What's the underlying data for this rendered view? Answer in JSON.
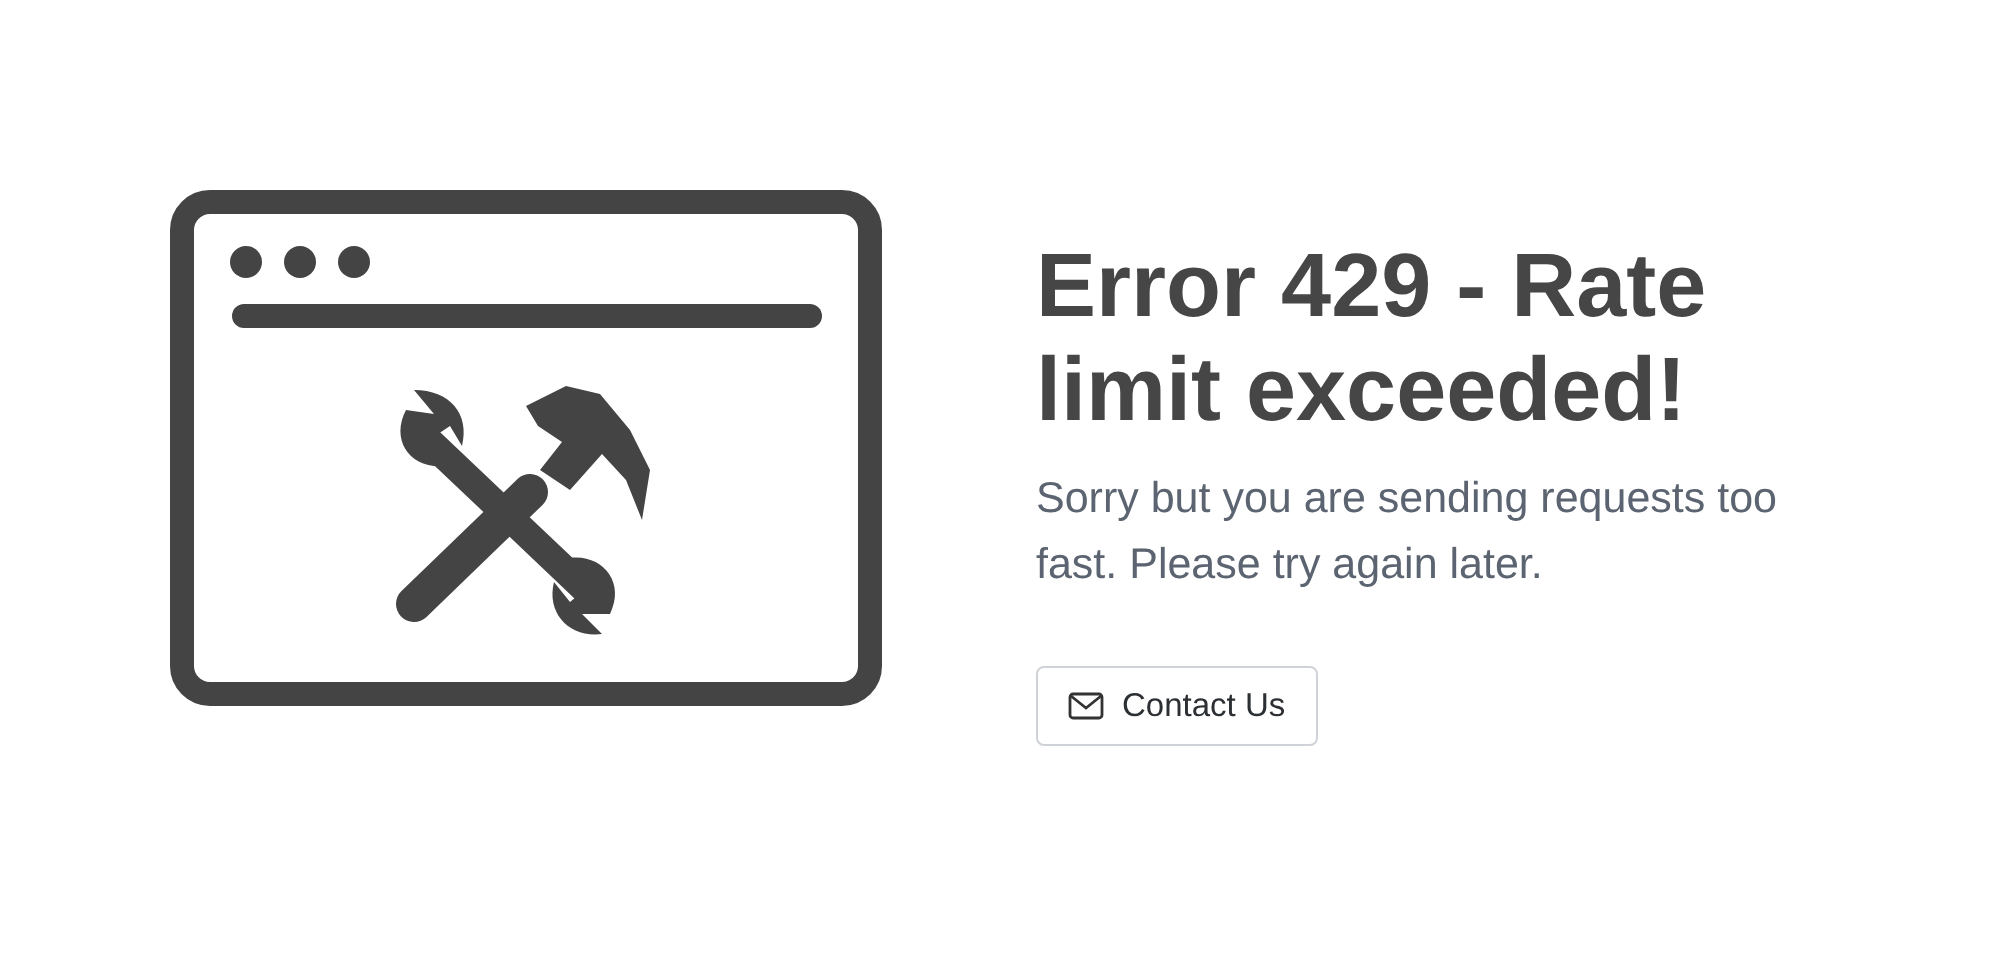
{
  "heading": "Error 429 - Rate limit exceeded!",
  "message": "Sorry but you are sending requests too fast. Please try again later.",
  "button": {
    "label": "Contact Us"
  }
}
